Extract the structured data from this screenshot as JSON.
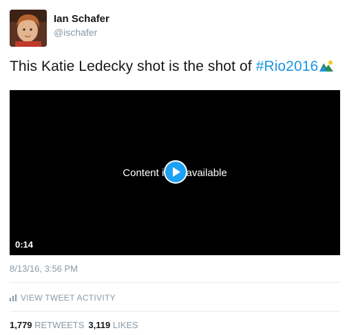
{
  "author": {
    "display_name": "Ian Schafer",
    "handle": "@ischafer"
  },
  "tweet": {
    "text_prefix": "This Katie Ledecky shot is the shot of ",
    "hashtag": "#Rio2016",
    "emoji": "rio-olympics-emoji-icon"
  },
  "video": {
    "message_before": "Content i",
    "message_after": " available",
    "duration": "0:14"
  },
  "meta": {
    "timestamp": "8/13/16, 3:56 PM",
    "activity_label": "VIEW TWEET ACTIVITY"
  },
  "stats": {
    "retweets_count": "1,779",
    "retweets_label": "RETWEETS",
    "likes_count": "3,119",
    "likes_label": "LIKES"
  },
  "colors": {
    "link": "#1b95e0",
    "play": "#1da1f2",
    "muted": "#8899a6"
  }
}
